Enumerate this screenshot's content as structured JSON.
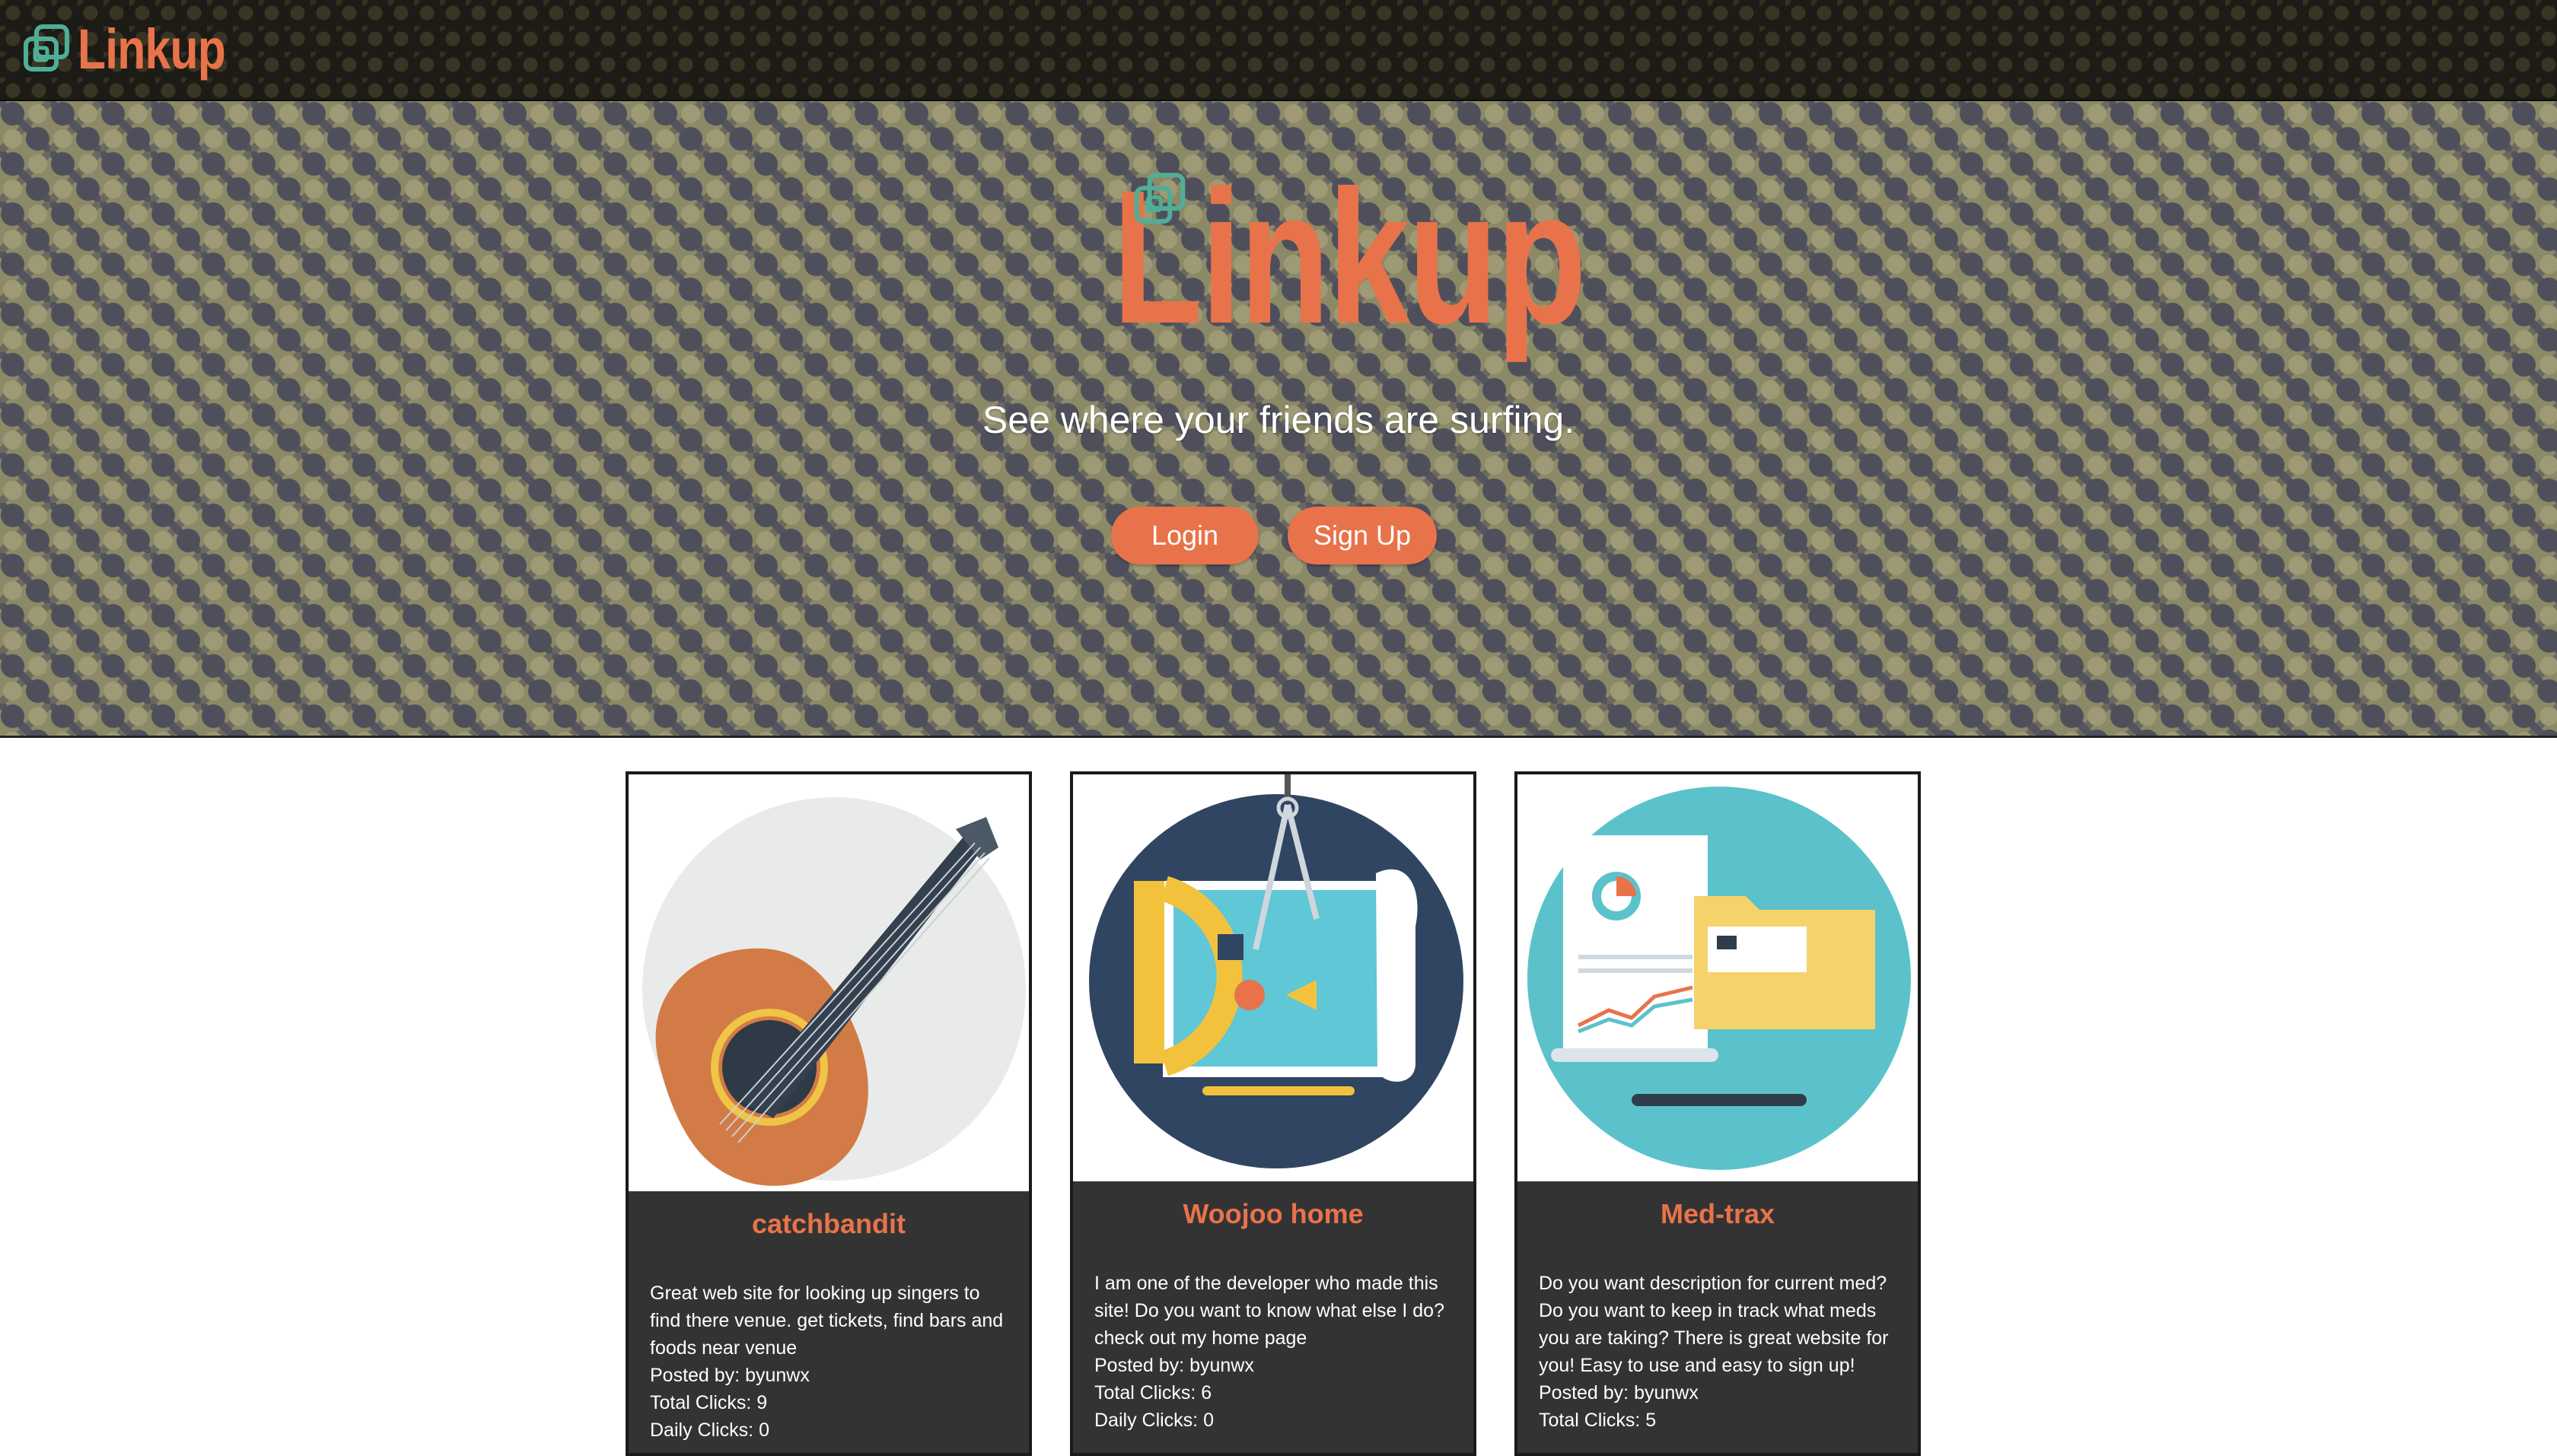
{
  "nav": {
    "brand": "Linkup",
    "logo_icon": "linked-squares-icon"
  },
  "hero": {
    "brand": "Linkup",
    "tagline": "See where your friends are surfing.",
    "login_label": "Login",
    "signup_label": "Sign Up"
  },
  "colors": {
    "accent": "#e8734a",
    "teal": "#4fae96",
    "card_body": "#333333",
    "navbar": "#1c1b15"
  },
  "cards": [
    {
      "image": "guitar-illustration",
      "title": "catchbandit",
      "description": "Great web site for looking up singers to find there venue. get tickets, find bars and foods near venue",
      "posted_by": "Posted by: byunwx",
      "total_clicks": "Total Clicks: 9",
      "daily_clicks": "Daily Clicks: 0"
    },
    {
      "image": "drafting-tools-illustration",
      "title": "Woojoo home",
      "description": "I am one of the developer who made this site! Do you want to know what else I do? check out my home page",
      "posted_by": "Posted by: byunwx",
      "total_clicks": "Total Clicks: 6",
      "daily_clicks": "Daily Clicks: 0"
    },
    {
      "image": "documents-folder-illustration",
      "title": "Med-trax",
      "description": "Do you want description for current med? Do you want to keep in track what meds you are taking? There is great website for you! Easy to use and easy to sign up!",
      "posted_by": "Posted by: byunwx",
      "total_clicks": "Total Clicks: 5"
    }
  ]
}
